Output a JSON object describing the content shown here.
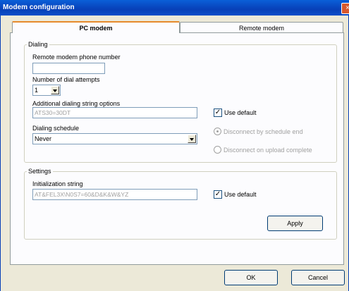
{
  "window": {
    "title": "Modem configuration",
    "close_symbol": "×"
  },
  "tabs": [
    {
      "label": "PC modem",
      "active": true
    },
    {
      "label": "Remote modem",
      "active": false
    }
  ],
  "dialing": {
    "group_label": "Dialing",
    "phone_label": "Remote modem phone number",
    "phone_value": "",
    "attempts_label": "Number of dial attempts",
    "attempts_value": "1",
    "options_label": "Additional dialing string options",
    "options_value": "ATS30=30DT",
    "use_default_label": "Use default",
    "use_default_checked": true,
    "schedule_label": "Dialing schedule",
    "schedule_value": "Never",
    "disconnect_schedule_label": "Disconnect by schedule end",
    "disconnect_upload_label": "Disconnect on upload complete"
  },
  "settings": {
    "group_label": "Settings",
    "init_label": "Initialization string",
    "init_value": "AT&FEL3X\\N0S7=60&D&K&W&YZ",
    "use_default_label": "Use default",
    "use_default_checked": true,
    "apply_label": "Apply"
  },
  "footer": {
    "ok_label": "OK",
    "cancel_label": "Cancel"
  },
  "checkmark": "✓"
}
